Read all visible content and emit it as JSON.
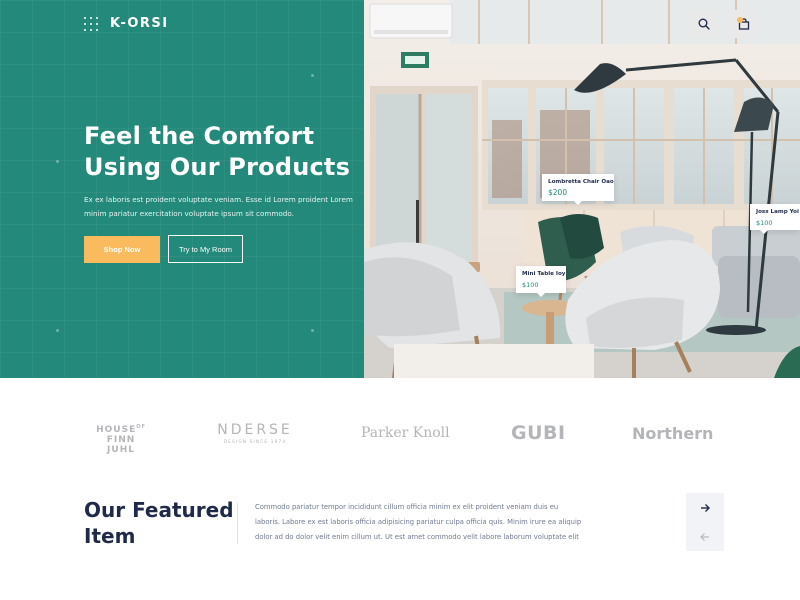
{
  "brand": {
    "name": "K-ORSI"
  },
  "hero": {
    "title_line1": "Feel the Comfort",
    "title_line2": "Using Our Products",
    "subtitle": "Ex ex laboris est proident voluptate veniam. Esse id Lorem proident Lorem minim pariatur exercitation voluptate ipsum sit commodo.",
    "shop_label": "Shop Now",
    "try_label": "Try to My Room"
  },
  "header_icons": {
    "search": "search-icon",
    "bag": "shopping-bag-icon"
  },
  "product_tags": [
    {
      "name": "Lombretta Chair Oao",
      "price": "$200"
    },
    {
      "name": "Joss Lamp Yoi",
      "price": "$100"
    },
    {
      "name": "Mini Table Ioy",
      "price": "$100"
    }
  ],
  "brands": [
    {
      "line1": "HOUSE",
      "sup": "OF",
      "line2": "FINN JUHL"
    },
    {
      "name": "NDERSE",
      "tagline": "DESIGN SINCE 1974"
    },
    {
      "name": "Parker Knoll"
    },
    {
      "name": "GUBI"
    },
    {
      "name": "Northern"
    }
  ],
  "featured": {
    "title_line1": "Our Featured",
    "title_line2": "Item",
    "description": "Commodo pariatur tempor incididunt cillum officia minim ex elit proident veniam duis eu laboris. Labore ex est laboris officia adipisicing pariatur culpa officia quis. Minim irure ea aliquip dolor ad do dolor velit enim cillum ut. Ut est amet commodo velit labore laborum voluptate elit"
  },
  "nav": {
    "next": "arrow-right-icon",
    "prev": "arrow-left-icon"
  },
  "colors": {
    "primary_teal": "#23897a",
    "accent_orange": "#f9bb5d",
    "navy_text": "#1f2a4a",
    "muted_text": "#6f7a8f",
    "logo_gray": "#b3b5b8"
  }
}
